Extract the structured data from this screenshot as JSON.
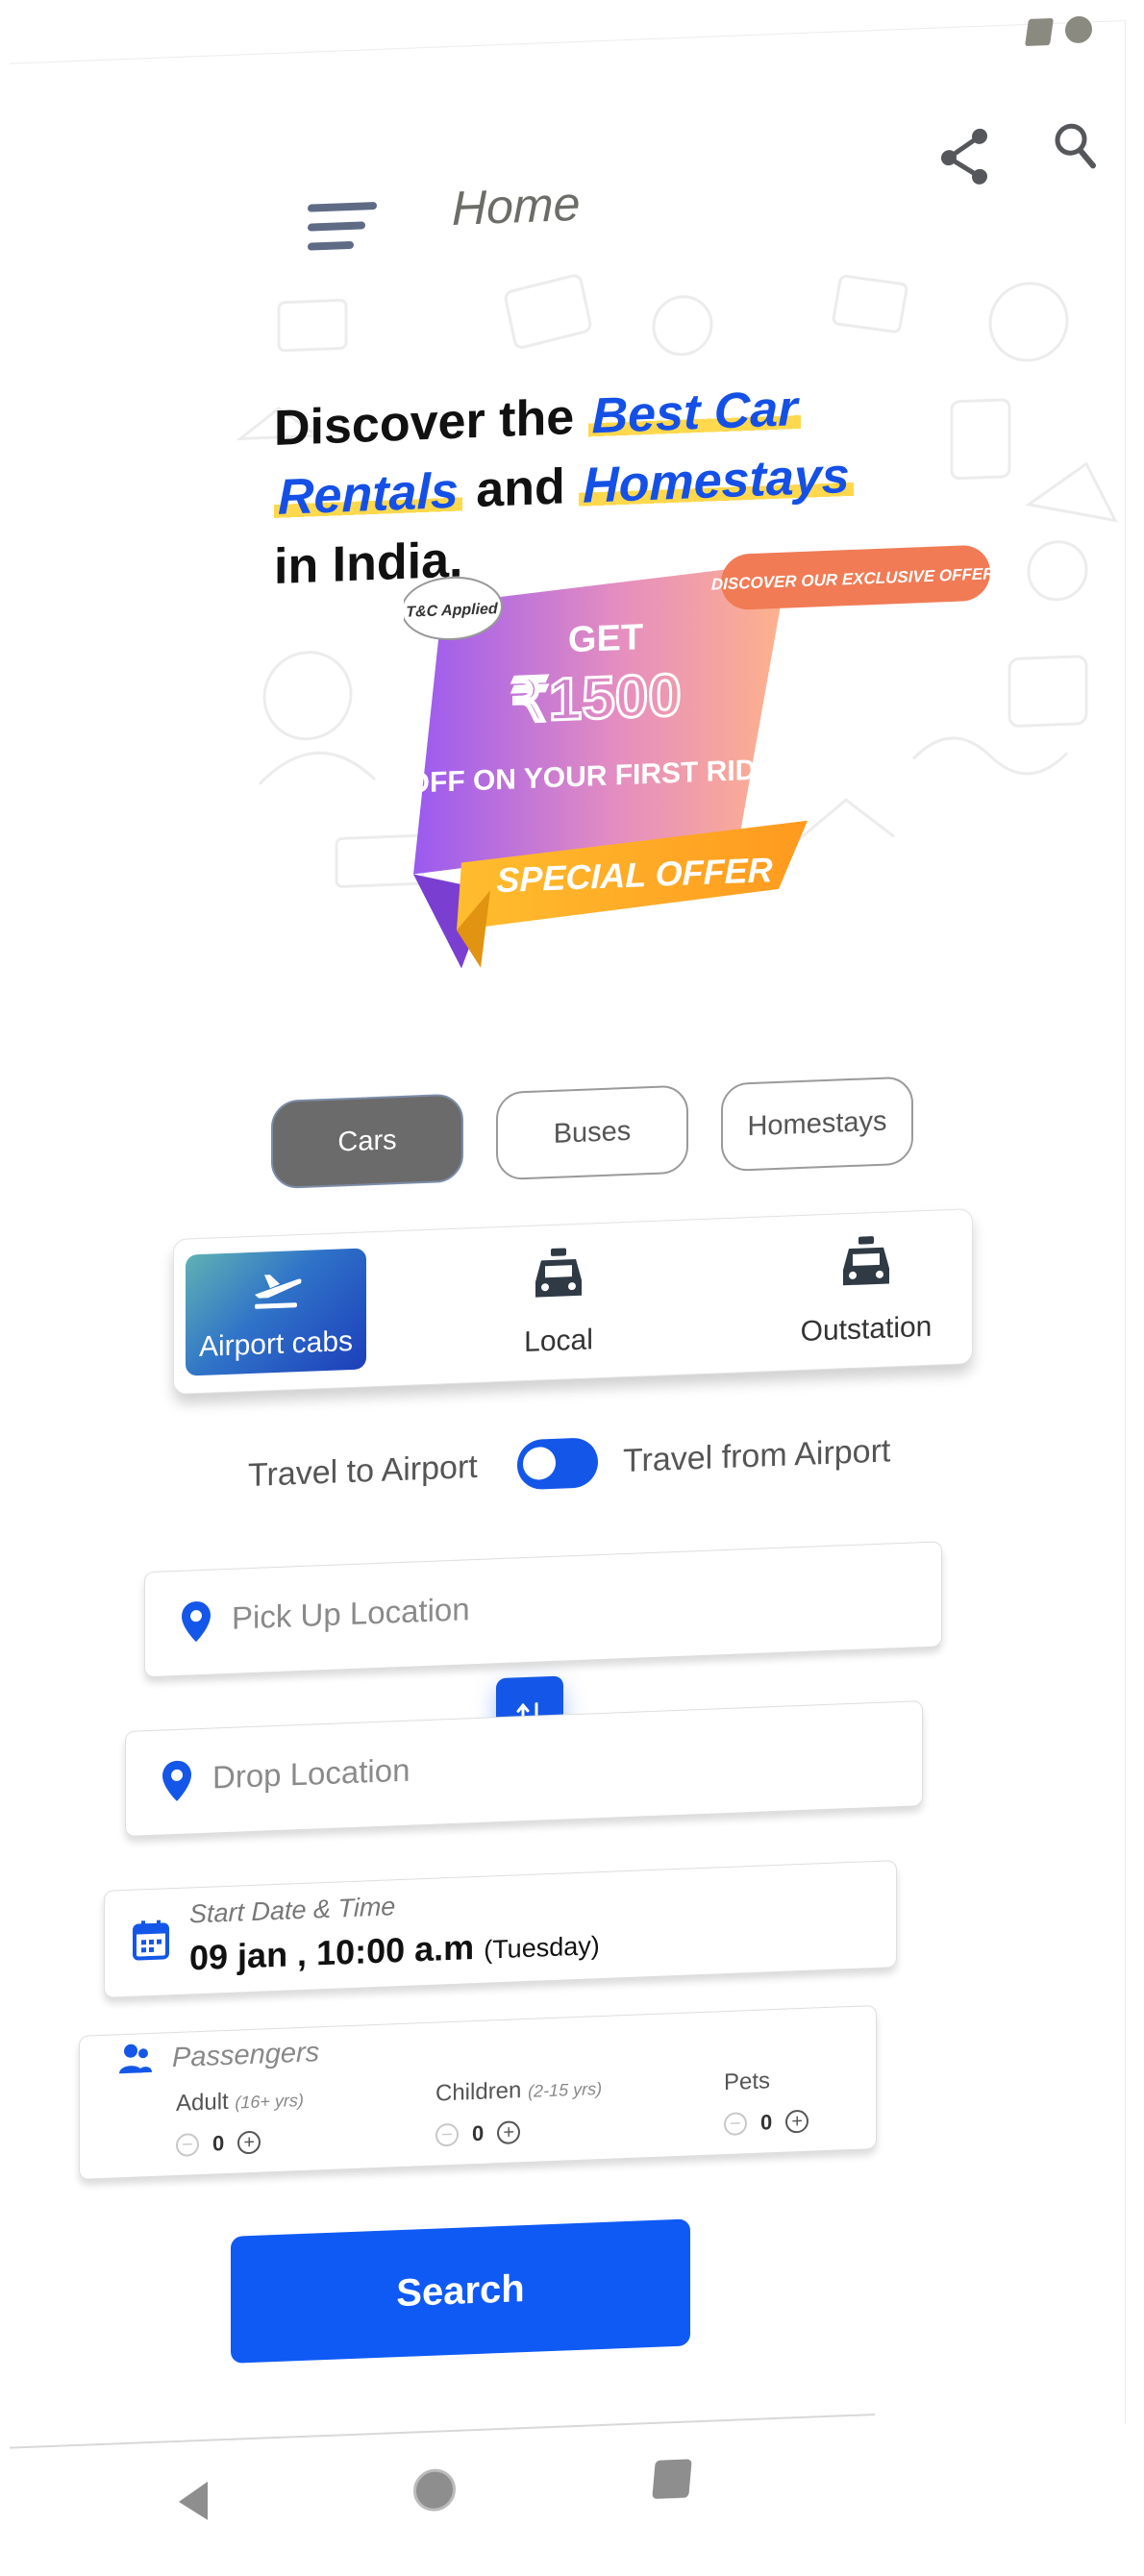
{
  "header": {
    "title": "Home"
  },
  "hero": {
    "line1_plain": "Discover the",
    "line1_blue": "Best Car",
    "line2_blue": "Rentals",
    "line2_plain": "and",
    "line2_blue2": "Homestays",
    "line3_plain": "in India."
  },
  "offer": {
    "badge_tc": "T&C Applied",
    "pill": "DISCOVER OUR EXCLUSIVE OFFER!",
    "get": "GET",
    "amount": "₹1500",
    "subtitle": "OFF ON YOUR FIRST RIDE",
    "ribbon": "SPECIAL OFFER"
  },
  "tabs": [
    {
      "label": "Cars",
      "active": true
    },
    {
      "label": "Buses",
      "active": false
    },
    {
      "label": "Homestays",
      "active": false
    }
  ],
  "services": [
    {
      "label": "Airport cabs",
      "icon": "airplane-departure-icon",
      "active": true
    },
    {
      "label": "Local",
      "icon": "taxi-icon",
      "active": false
    },
    {
      "label": "Outstation",
      "icon": "taxi-icon",
      "active": false
    }
  ],
  "direction": {
    "left_label": "Travel to Airport",
    "right_label": "Travel from Airport",
    "toggle_on": true
  },
  "form": {
    "pickup_placeholder": "Pick Up Location",
    "drop_placeholder": "Drop Location",
    "date_label": "Start Date & Time",
    "date_value": "09 jan , 10:00 a.m",
    "date_day": "(Tuesday)",
    "passengers_label": "Passengers",
    "passengers": [
      {
        "label": "Adult",
        "age": "(16+ yrs)",
        "value": "0"
      },
      {
        "label": "Children",
        "age": "(2-15 yrs)",
        "value": "0"
      },
      {
        "label": "Pets",
        "age": "",
        "value": "0"
      }
    ],
    "search_label": "Search"
  },
  "colors": {
    "accent": "#1457e8",
    "highlight": "#ffd84d",
    "tab_active": "#6b6b6b"
  }
}
